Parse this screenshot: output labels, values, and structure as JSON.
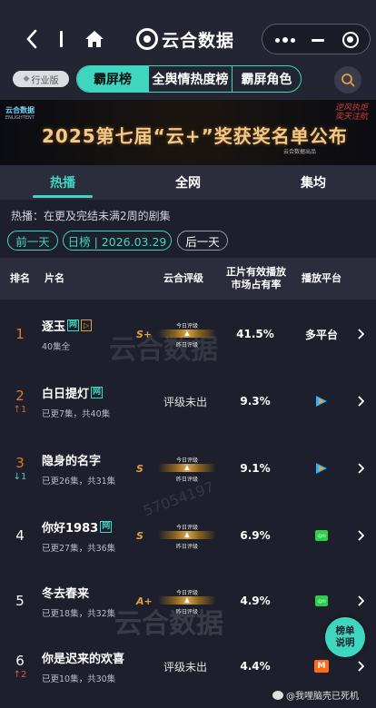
{
  "header": {
    "title": "云合数据"
  },
  "filters": {
    "industry_label": "行业版",
    "segments": [
      "霸屏榜",
      "全舆情热度榜",
      "霸屏角色"
    ]
  },
  "banner": {
    "logo": "云合数据",
    "logo_sub": "ENLIGHTENT",
    "title": "2025第七届“云+”奖获奖名单公布",
    "sub": "云合数据出品",
    "deco": "逆风执炬 奕天注航"
  },
  "tabs": [
    "热播",
    "全网",
    "集均"
  ],
  "hot_desc": "热播：在更及完结未满2周的剧集",
  "date_nav": {
    "prev": "前一天",
    "current": "日榜 | 2026.03.29",
    "next": "后一天"
  },
  "table": {
    "headers": {
      "rank": "排名",
      "name": "片名",
      "rating": "云合评级",
      "share_l1": "正片有效播放",
      "share_l2": "市场占有率",
      "platform": "播放平台"
    },
    "gauge_top": "今日评级",
    "gauge_bottom": "昨日评级",
    "rows": [
      {
        "rank": "1",
        "move": "",
        "name": "逐玉",
        "net_tag": "网",
        "play_tag": "▷",
        "episodes": "40集全",
        "grade": "S+",
        "share": "41.5%",
        "platform": "多平台"
      },
      {
        "rank": "2",
        "move": "↑1",
        "name": "白日提灯",
        "net_tag": "网",
        "episodes": "已更7集，共40集",
        "no_rating": "评级未出",
        "share": "9.3%",
        "platform": "tencent"
      },
      {
        "rank": "3",
        "move": "↓1",
        "name": "隐身的名字",
        "net_tag": "",
        "episodes": "已更26集，共31集",
        "grade": "S",
        "share": "9.1%",
        "platform": "tencent"
      },
      {
        "rank": "4",
        "move": "",
        "name": "你好1983",
        "net_tag": "网",
        "episodes": "已更27集，共36集",
        "grade": "S",
        "share": "6.9%",
        "platform": "iqiyi"
      },
      {
        "rank": "5",
        "move": "",
        "name": "冬去春来",
        "net_tag": "",
        "episodes": "已更18集，共32集",
        "grade": "A+",
        "share": "4.9%",
        "platform": "iqiyi"
      },
      {
        "rank": "6",
        "move": "↑2",
        "name": "你是迟来的欢喜",
        "net_tag": "",
        "episodes": "已更10集，共30集",
        "no_rating": "评级未出",
        "share": "4.4%",
        "platform": "mango"
      }
    ]
  },
  "fab": {
    "line1": "榜单",
    "line2": "说明"
  },
  "watermark": {
    "brand": "云合数据",
    "id": "57054197"
  },
  "weibo": "@我哩脑壳已死机",
  "colors": {
    "accent": "#3fd6c0",
    "rank": "#e07a2a",
    "grade": "#e0a040",
    "up": "#e05a3a"
  }
}
